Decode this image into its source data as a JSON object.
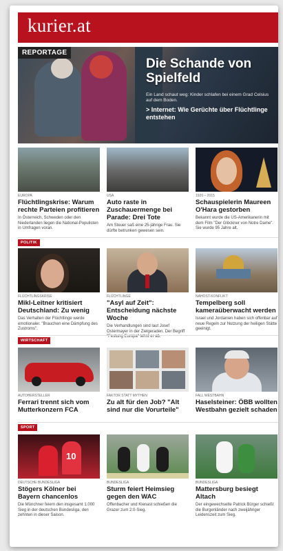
{
  "masthead": {
    "logo": "kurier.at"
  },
  "hero": {
    "tag": "REPORTAGE",
    "headline": "Die Schande von Spielfeld",
    "teaser": "Ein Land schaut weg: Kinder schlafen bei einem Grad Celsius auf dem Boden.",
    "link": "> Internet: Wie Gerüchte über Flüchtlinge entstehen"
  },
  "top": [
    {
      "kicker": "EUROPA",
      "title": "Flüchtlingskrise: Warum rechte Parteien profitieren",
      "desc": "In Österreich, Schweden oder den Niederlanden liegen die National-Populisten in Umfragen voran."
    },
    {
      "kicker": "USA",
      "title": "Auto raste in Zuschauermenge bei Parade: Drei Tote",
      "desc": "Am Steuer saß eine 25-jährige Frau. Sie dürfte betrunken gewesen sein."
    },
    {
      "kicker": "1920 – 2015",
      "title": "Schauspielerin Maureen O'Hara gestorben",
      "desc": "Bekannt wurde die US-Amerikanerin mit dem Film \"Der Glöckner von Notre Dame\". Sie wurde 95 Jahre alt."
    }
  ],
  "politik": {
    "tag": "POLITIK",
    "cards": [
      {
        "kicker": "FLÜCHTLINGSKRISE",
        "title": "Mikl-Leitner kritisiert Deutschland: Zu wenig",
        "desc": "Das Verhalten der Flüchtlinge werde emotionaler. \"Brauchen eine Dämpfung des Zustroms\"."
      },
      {
        "kicker": "FLÜCHTLINGE",
        "title": "\"Asyl auf Zeit\": Entscheidung nächste Woche",
        "desc": "Die Verhandlungen sind laut Josef Ostermayer in der Zielgeraden. Der Begriff \"Festung Europa\" lehnt er ab."
      },
      {
        "kicker": "NAHOST-KONFLIKT",
        "title": "Tempelberg soll kameraüberwacht werden",
        "desc": "Israel und Jordanien haben sich offenbar auf neue Regeln zur Nutzung der heiligen Stätte geeinigt."
      }
    ]
  },
  "wirtschaft": {
    "tag": "WIRTSCHAFT",
    "cards": [
      {
        "kicker": "AUTOHERSTELLER",
        "title": "Ferrari trennt sich vom Mutterkonzern FCA",
        "desc": ""
      },
      {
        "kicker": "FAKTOR STATT MYTHEN",
        "title": "Zu alt für den Job? \"Alt sind nur die Vorurteile\"",
        "desc": ""
      },
      {
        "kicker": "FALL WESTBAHN",
        "title": "Haselsteiner: ÖBB wollten Westbahn gezielt schaden",
        "desc": ""
      }
    ]
  },
  "sport": {
    "tag": "SPORT",
    "cards": [
      {
        "kicker": "DEUTSCHE BUNDESLIGA",
        "title": "Stögers Kölner bei Bayern chancenlos",
        "desc": "Die Münchner feiern den insgesamt 1.000 Sieg in der deutschen Bundesliga, den zehnten in dieser Saison."
      },
      {
        "kicker": "BUNDESLIGA",
        "title": "Sturm feiert Heimsieg gegen den WAC",
        "desc": "Offenbacher und Kienast schießen die Grazer zum 2:0-Sieg."
      },
      {
        "kicker": "BUNDESLIGA",
        "title": "Mattersburg besiegt Altach",
        "desc": "Der eingewechselte Patrick Bürger schießt die Burgenländer nach zweijähriger Leidenszeit zum Sieg."
      }
    ]
  }
}
